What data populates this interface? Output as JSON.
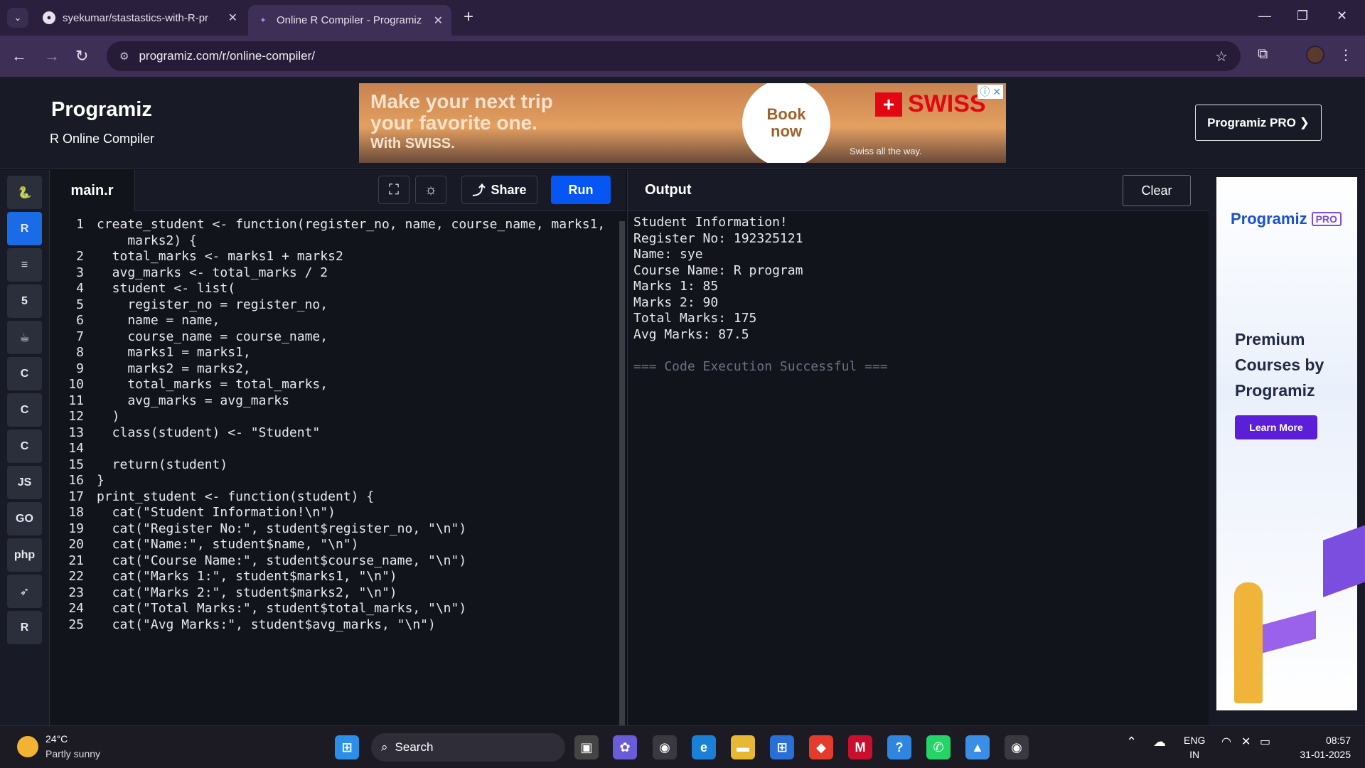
{
  "browser": {
    "tabs": [
      {
        "title": "syekumar/stastastics-with-R-pr",
        "icon": "github-icon"
      },
      {
        "title": "Online R Compiler - Programiz",
        "icon": "programiz-icon"
      }
    ],
    "url": "programiz.com/r/online-compiler/"
  },
  "header": {
    "logo": "Programiz",
    "subtitle": "R Online Compiler",
    "pro_button": "Programiz PRO ❯"
  },
  "ad": {
    "line1": "Make your next trip",
    "line2": "your favorite one.",
    "line3": "With SWISS.",
    "cta_line1": "Book",
    "cta_line2": "now",
    "brand": "SWISS",
    "tagline": "Swiss   all   the   way."
  },
  "rail": {
    "items": [
      {
        "name": "python-icon",
        "glyph": "🐍"
      },
      {
        "name": "r-icon",
        "glyph": "R",
        "active": true
      },
      {
        "name": "sql-icon",
        "glyph": "≡"
      },
      {
        "name": "html-icon",
        "glyph": "5"
      },
      {
        "name": "java-icon",
        "glyph": "☕"
      },
      {
        "name": "c-icon",
        "glyph": "C"
      },
      {
        "name": "cpp-icon",
        "glyph": "C"
      },
      {
        "name": "csharp-icon",
        "glyph": "C"
      },
      {
        "name": "js-icon",
        "glyph": "JS"
      },
      {
        "name": "go-icon",
        "glyph": "GO"
      },
      {
        "name": "php-icon",
        "glyph": "php"
      },
      {
        "name": "swift-icon",
        "glyph": "➶"
      },
      {
        "name": "rust-icon",
        "glyph": "R"
      }
    ]
  },
  "editor": {
    "filename": "main.r",
    "share_label": "Share",
    "run_label": "Run",
    "lines": [
      {
        "n": "1",
        "code": "create_student <- function(register_no, name, course_name, marks1,"
      },
      {
        "n": "",
        "code": "    marks2) {"
      },
      {
        "n": "2",
        "code": "  total_marks <- marks1 + marks2"
      },
      {
        "n": "3",
        "code": "  avg_marks <- total_marks / 2"
      },
      {
        "n": "4",
        "code": "  student <- list("
      },
      {
        "n": "5",
        "code": "    register_no = register_no,"
      },
      {
        "n": "6",
        "code": "    name = name,"
      },
      {
        "n": "7",
        "code": "    course_name = course_name,"
      },
      {
        "n": "8",
        "code": "    marks1 = marks1,"
      },
      {
        "n": "9",
        "code": "    marks2 = marks2,"
      },
      {
        "n": "10",
        "code": "    total_marks = total_marks,"
      },
      {
        "n": "11",
        "code": "    avg_marks = avg_marks"
      },
      {
        "n": "12",
        "code": "  )"
      },
      {
        "n": "13",
        "code": "  class(student) <- \"Student\""
      },
      {
        "n": "14",
        "code": ""
      },
      {
        "n": "15",
        "code": "  return(student)"
      },
      {
        "n": "16",
        "code": "}"
      },
      {
        "n": "17",
        "code": "print_student <- function(student) {"
      },
      {
        "n": "18",
        "code": "  cat(\"Student Information!\\n\")"
      },
      {
        "n": "19",
        "code": "  cat(\"Register No:\", student$register_no, \"\\n\")"
      },
      {
        "n": "20",
        "code": "  cat(\"Name:\", student$name, \"\\n\")"
      },
      {
        "n": "21",
        "code": "  cat(\"Course Name:\", student$course_name, \"\\n\")"
      },
      {
        "n": "22",
        "code": "  cat(\"Marks 1:\", student$marks1, \"\\n\")"
      },
      {
        "n": "23",
        "code": "  cat(\"Marks 2:\", student$marks2, \"\\n\")"
      },
      {
        "n": "24",
        "code": "  cat(\"Total Marks:\", student$total_marks, \"\\n\")"
      },
      {
        "n": "25",
        "code": "  cat(\"Avg Marks:\", student$avg_marks, \"\\n\")"
      }
    ]
  },
  "output": {
    "title": "Output",
    "clear_label": "Clear",
    "lines": [
      "Student Information!",
      "Register No: 192325121",
      "Name: sye",
      "Course Name: R program",
      "Marks 1: 85",
      "Marks 2: 90",
      "Total Marks: 175",
      "Avg Marks: 87.5",
      "",
      "=== Code Execution Successful ==="
    ]
  },
  "pro_ad": {
    "logo": "Programiz",
    "badge": "PRO",
    "headline": "Premium Courses by Programiz",
    "cta": "Learn More"
  },
  "taskbar": {
    "temp": "24°C",
    "weather": "Partly sunny",
    "search_placeholder": "Search",
    "lang_line1": "ENG",
    "lang_line2": "IN",
    "time": "08:57",
    "date": "31-01-2025"
  }
}
